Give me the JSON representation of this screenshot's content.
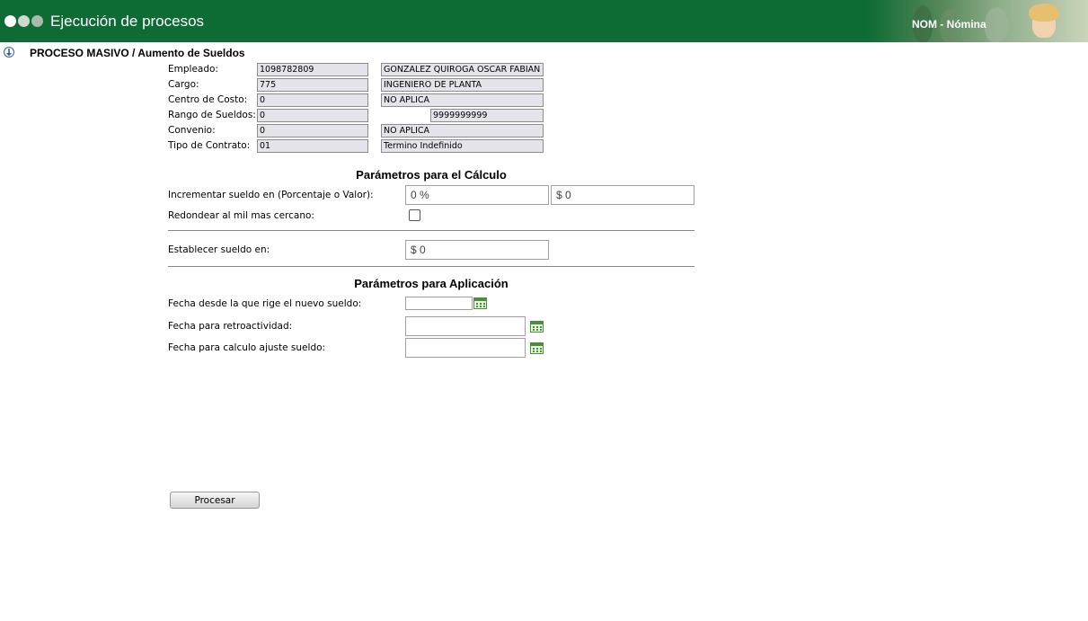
{
  "header": {
    "app_title": "Ejecución de procesos",
    "module_label": "NOM - Nómina",
    "dot_colors": [
      "#ffffff",
      "#cfd8cf",
      "#aabaa9"
    ],
    "bar_color": "#0e6b34"
  },
  "page": {
    "title": "PROCESO MASIVO / Aumento de Sueldos",
    "info_icon": "info-icon"
  },
  "employee_info": {
    "empleado": {
      "label": "Empleado:",
      "code": "1098782809",
      "desc": "GONZALEZ QUIROGA OSCAR FABIAN"
    },
    "cargo": {
      "label": "Cargo:",
      "code": "775",
      "desc": "INGENIERO DE PLANTA"
    },
    "centro_costo": {
      "label": "Centro de Costo:",
      "code": "0",
      "desc": "NO APLICA"
    },
    "rango_sueldos": {
      "label": "Rango de Sueldos:",
      "from": "0",
      "to": "9999999999"
    },
    "convenio": {
      "label": "Convenio:",
      "code": "0",
      "desc": "NO APLICA"
    },
    "tipo_contrato": {
      "label": "Tipo de Contrato:",
      "code": "01",
      "desc": "Termino Indefinido"
    }
  },
  "calc_params": {
    "title": "Parámetros para el Cálculo",
    "increment_label": "Incrementar sueldo en (Porcentaje o Valor):",
    "increment_percent": "0 %",
    "increment_value": "$ 0",
    "round_label": "Redondear al mil mas cercano:",
    "round_checked": false,
    "set_salary_label": "Establecer sueldo en:",
    "set_salary_value": "$ 0"
  },
  "apply_params": {
    "title": "Parámetros para Aplicación",
    "fecha_rige_label": "Fecha desde la que rige el nuevo sueldo:",
    "fecha_rige_value": "",
    "fecha_retro_label": "Fecha para retroactividad:",
    "fecha_retro_value": "",
    "fecha_ajuste_label": "Fecha para calculo ajuste sueldo:",
    "fecha_ajuste_value": ""
  },
  "actions": {
    "process_label": "Procesar"
  }
}
